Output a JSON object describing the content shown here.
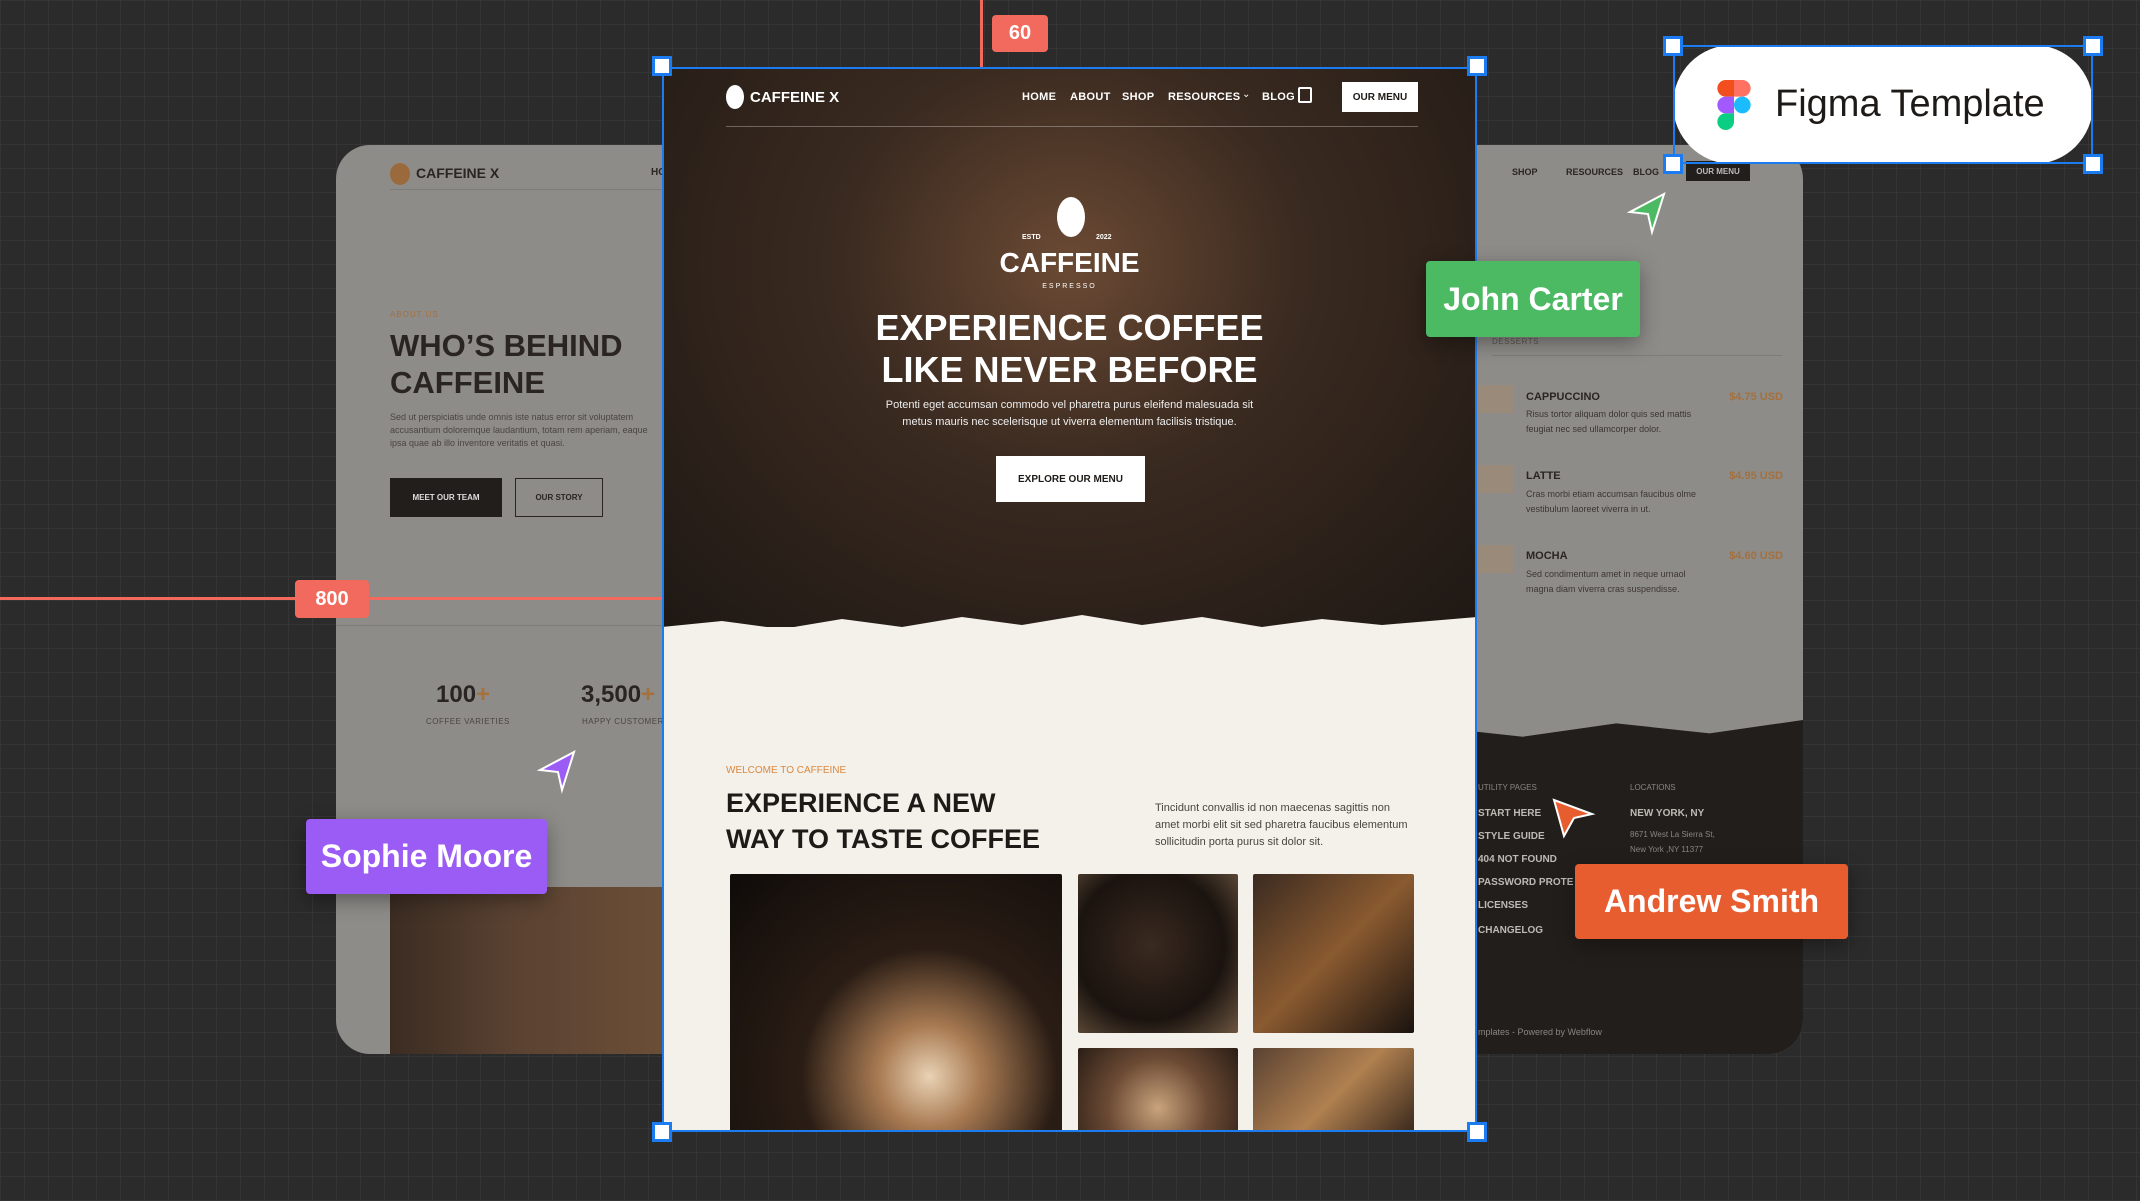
{
  "rulers": {
    "top": "60",
    "left": "800"
  },
  "badge": {
    "label": "Figma Template",
    "icon": "figma-logo-icon"
  },
  "collaborators": [
    {
      "name": "John Carter",
      "color": "#4cb963"
    },
    {
      "name": "Sophie Moore",
      "color": "#9b5cf6"
    },
    {
      "name": "Andrew Smith",
      "color": "#e85d30"
    }
  ],
  "colors": {
    "selection": "#1a7cf0",
    "accent": "#d9893f",
    "cream": "#f4f0ea",
    "dark": "#221e1b"
  },
  "left_page": {
    "logo": "CAFFEINE X",
    "nav_partial": "HO",
    "eyebrow": "ABOUT US",
    "title_1": "WHO’S BEHIND",
    "title_2": "CAFFEINE",
    "text": "Sed ut perspiciatis unde omnis iste natus error sit voluptatem accusantium doloremque laudantium, totam rem aperiam, eaque ipsa quae ab illo inventore veritatis et quasi.",
    "btn_primary": "MEET OUR TEAM",
    "btn_secondary": "OUR STORY",
    "stats": [
      {
        "value": "100",
        "suffix": "+",
        "label": "COFFEE VARIETIES"
      },
      {
        "value": "3,500",
        "suffix": "+",
        "label": "HAPPY CUSTOMER"
      }
    ]
  },
  "main_page": {
    "logo": "CAFFEINE X",
    "nav": [
      "HOME",
      "ABOUT",
      "SHOP",
      "RESOURCES",
      "BLOG"
    ],
    "cta": "OUR MENU",
    "emblem": {
      "estd": "ESTD",
      "year": "2022",
      "name": "CAFFEINE",
      "sub": "ESPRESSO"
    },
    "hero_title_1": "EXPERIENCE COFFEE",
    "hero_title_2": "LIKE NEVER BEFORE",
    "hero_text_1": "Potenti eget accumsan commodo vel pharetra purus eleifend malesuada sit",
    "hero_text_2": "metus mauris nec scelerisque ut viverra elementum facilisis tristique.",
    "hero_button": "EXPLORE OUR MENU",
    "eyebrow": "WELCOME TO CAFFEINE",
    "title_1": "EXPERIENCE A NEW",
    "title_2": "WAY TO TASTE COFFEE",
    "text": "Tincidunt convallis id non maecenas sagittis non amet morbi elit sit sed pharetra faucibus elementum sollicitudin porta purus sit dolor sit."
  },
  "right_page": {
    "nav": [
      "SHOP",
      "RESOURCES",
      "BLOG"
    ],
    "cta": "OUR MENU",
    "category": "DESSERTS",
    "menu": [
      {
        "name": "CAPPUCCINO",
        "price": "$4.75 USD",
        "desc": "Risus tortor aliquam dolor quis sed mattis feugiat nec sed ullamcorper dolor."
      },
      {
        "name": "LATTE",
        "price": "$4.95 USD",
        "desc": "Cras morbi etiam accumsan faucibus olme vestibulum laoreet viverra in ut."
      },
      {
        "name": "MOCHA",
        "price": "$4.60 USD",
        "desc": "Sed condimentum amet in neque urnaol magna diam viverra cras suspendisse."
      }
    ],
    "utility_heading": "UTILITY PAGES",
    "utility_links": [
      "START HERE",
      "STYLE GUIDE",
      "404 NOT FOUND",
      "PASSWORD PROTE",
      "LICENSES",
      "CHANGELOG"
    ],
    "locations_heading": "LOCATIONS",
    "city": "NEW YORK, NY",
    "address_1": "8671 West La Sierra St,",
    "address_2": "New York ,NY 11377",
    "credit": "mplates - Powered by Webflow"
  }
}
